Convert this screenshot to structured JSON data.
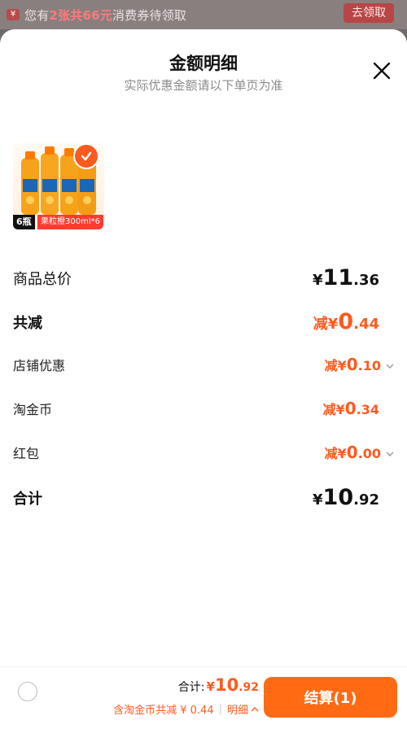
{
  "banner": {
    "text_prefix": "您有",
    "highlight": "2张共66元",
    "text_suffix": "消费券待领取",
    "button": "去领取"
  },
  "sheet": {
    "title": "金额明细",
    "subtitle": "实际优惠金额请以下单页为准",
    "product": {
      "qty_tag": "6瓶",
      "desc_tag": "果粒橙300ml*6"
    },
    "rows": [
      {
        "label": "商品总价",
        "prefix": "¥",
        "int": "11",
        "dec": ".36"
      },
      {
        "label": "共减",
        "prefix": "减¥",
        "int": "0",
        "dec": ".44"
      },
      {
        "label": "店铺优惠",
        "prefix": "减¥",
        "int": "0",
        "dec": ".10"
      },
      {
        "label": "淘金币",
        "prefix": "减¥",
        "int": "0",
        "dec": ".34"
      },
      {
        "label": "红包",
        "prefix": "减¥",
        "int": "0",
        "dec": ".00"
      },
      {
        "label": "合计",
        "prefix": "¥",
        "int": "10",
        "dec": ".92"
      }
    ]
  },
  "bottom": {
    "total_label": "合计:",
    "total_symbol": "¥",
    "total_int": "10",
    "total_dec": ".92",
    "sub_text": "含淘金币共减 ¥ 0.44",
    "detail_label": "明细",
    "checkout_label": "结算(1)"
  },
  "colors": {
    "accent": "#ff5a1f",
    "checkout": "#ff6a13"
  }
}
